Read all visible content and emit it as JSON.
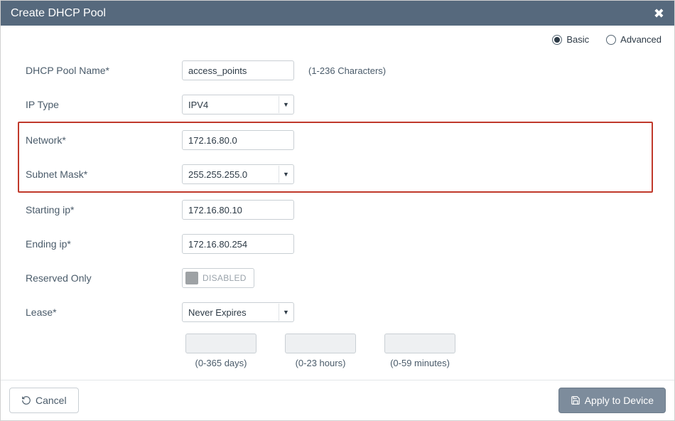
{
  "dialog": {
    "title": "Create DHCP Pool"
  },
  "view": {
    "basic": "Basic",
    "advanced": "Advanced"
  },
  "form": {
    "name_label": "DHCP Pool Name*",
    "name_value": "access_points",
    "name_hint": "(1-236 Characters)",
    "iptype_label": "IP Type",
    "iptype_value": "IPV4",
    "network_label": "Network*",
    "network_value": "172.16.80.0",
    "mask_label": "Subnet Mask*",
    "mask_value": "255.255.255.0",
    "start_label": "Starting ip*",
    "start_value": "172.16.80.10",
    "end_label": "Ending ip*",
    "end_value": "172.16.80.254",
    "reserved_label": "Reserved Only",
    "reserved_state": "DISABLED",
    "lease_label": "Lease*",
    "lease_value": "Never Expires",
    "days_hint": "(0-365 days)",
    "hours_hint": "(0-23 hours)",
    "minutes_hint": "(0-59 minutes)"
  },
  "actions": {
    "cancel": "Cancel",
    "apply": "Apply to Device"
  }
}
